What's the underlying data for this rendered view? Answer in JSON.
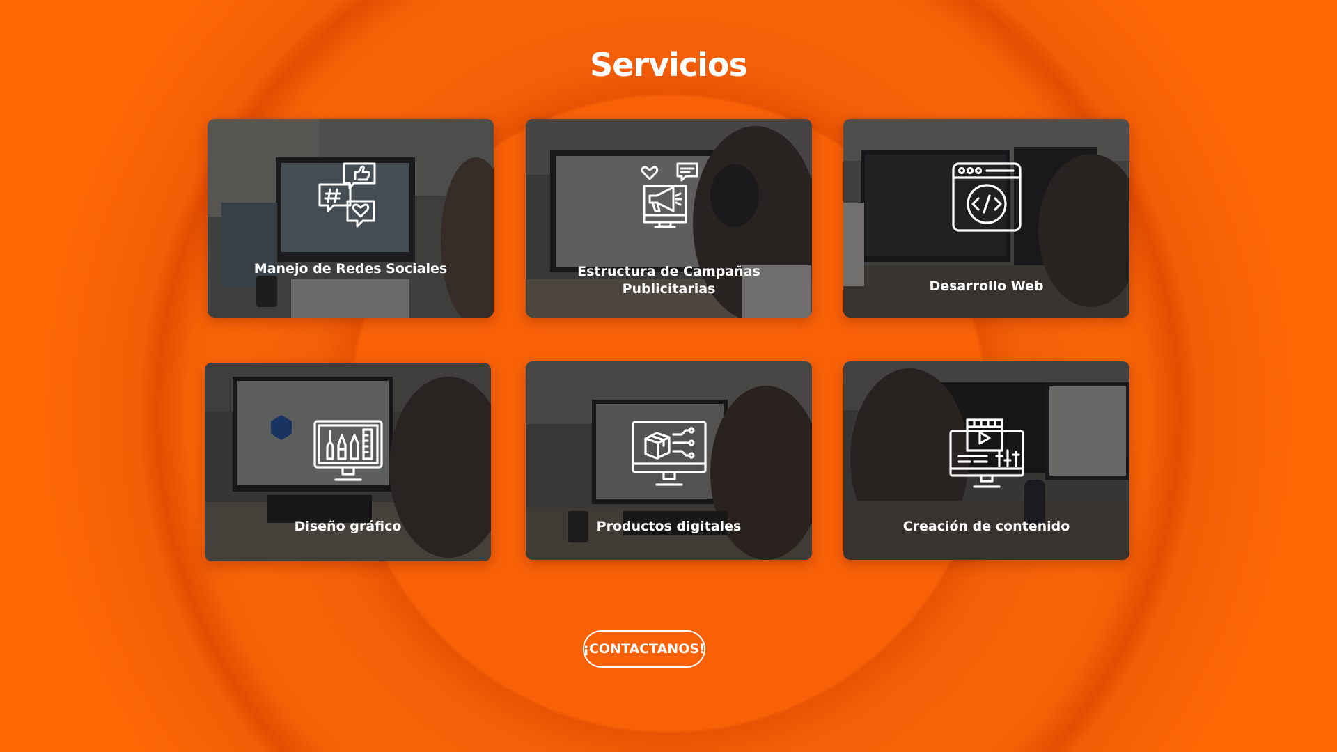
{
  "page": {
    "title": "Servicios"
  },
  "services": [
    {
      "label": "Manejo de Redes Sociales",
      "icon": "social-media-icon"
    },
    {
      "label": "Estructura de Campañas Publicitarias",
      "icon": "advertising-campaign-icon"
    },
    {
      "label": "Desarrollo Web",
      "icon": "web-development-icon"
    },
    {
      "label": "Diseño gráfico",
      "icon": "graphic-design-icon"
    },
    {
      "label": "Productos digitales",
      "icon": "digital-products-icon"
    },
    {
      "label": "Creación de contenido",
      "icon": "content-creation-icon"
    }
  ],
  "cta": {
    "label": "¡CONTACTANOS!"
  },
  "colors": {
    "accent": "#fd6805",
    "ring_shadow": "#e24d02",
    "card_overlay": "#19191c",
    "text": "#ffffff"
  }
}
